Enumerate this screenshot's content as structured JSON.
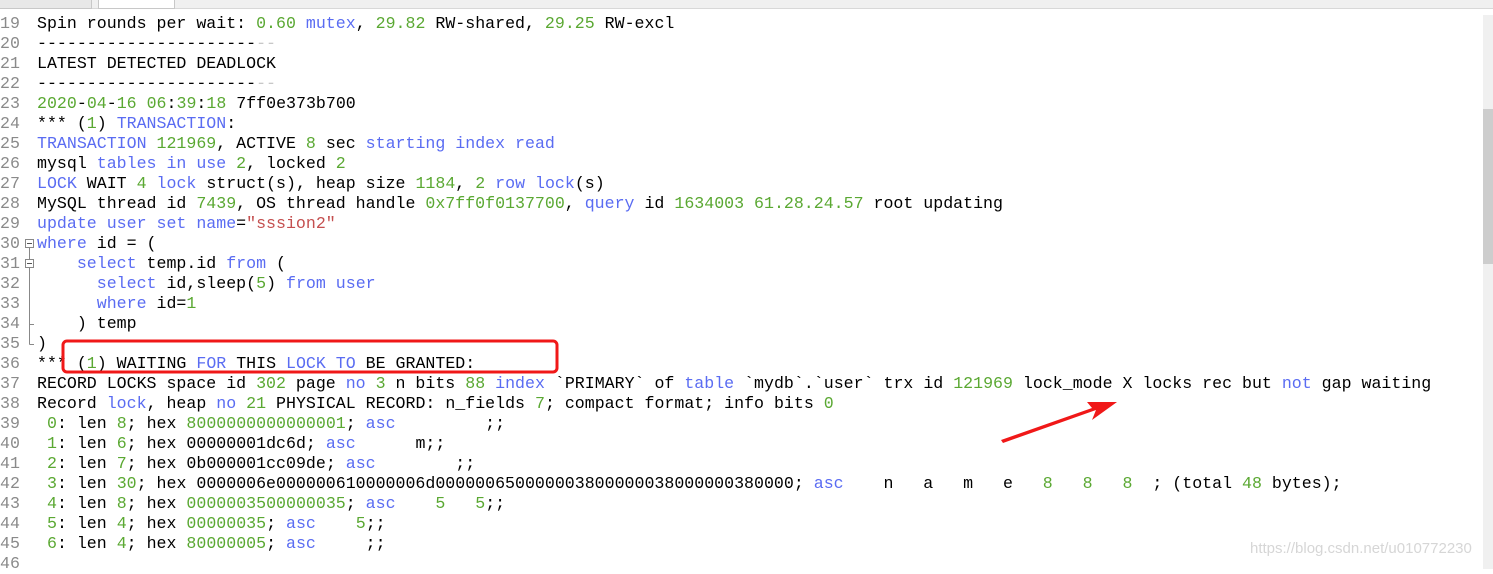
{
  "colors": {
    "keyword": "#5a6cf2",
    "number": "#5aa832",
    "string": "#c44f4f",
    "faded": "#c8c8c8",
    "annotation": "#f01818"
  },
  "lines": [
    {
      "n": "19",
      "t": [
        [
          "Spin rounds per wait: ",
          ""
        ],
        [
          "0.60",
          "n"
        ],
        [
          " ",
          ""
        ],
        [
          "mutex",
          "k"
        ],
        [
          ", ",
          ""
        ],
        [
          "29.82",
          "n"
        ],
        [
          " RW-shared, ",
          ""
        ],
        [
          "29.25",
          "n"
        ],
        [
          " RW-excl",
          ""
        ]
      ]
    },
    {
      "n": "20",
      "t": [
        [
          "----------------------",
          ""
        ],
        [
          "--",
          "d"
        ]
      ]
    },
    {
      "n": "21",
      "t": [
        [
          "LATEST DETECTED DEADLOCK",
          ""
        ]
      ]
    },
    {
      "n": "22",
      "t": [
        [
          "----------------------",
          ""
        ],
        [
          "--",
          "d"
        ]
      ]
    },
    {
      "n": "23",
      "t": [
        [
          "2020",
          "n"
        ],
        [
          "-",
          ""
        ],
        [
          "04",
          "n"
        ],
        [
          "-",
          ""
        ],
        [
          "16",
          "n"
        ],
        [
          " ",
          ""
        ],
        [
          "06",
          "n"
        ],
        [
          ":",
          ""
        ],
        [
          "39",
          "n"
        ],
        [
          ":",
          ""
        ],
        [
          "18",
          "n"
        ],
        [
          " 7ff0e373b700",
          ""
        ]
      ]
    },
    {
      "n": "24",
      "t": [
        [
          "*** (",
          ""
        ],
        [
          "1",
          "n"
        ],
        [
          ") ",
          ""
        ],
        [
          "TRANSACTION",
          "k"
        ],
        [
          ":",
          ""
        ]
      ]
    },
    {
      "n": "25",
      "t": [
        [
          "TRANSACTION",
          "k"
        ],
        [
          " ",
          ""
        ],
        [
          "121969",
          "n"
        ],
        [
          ", ACTIVE ",
          ""
        ],
        [
          "8",
          "n"
        ],
        [
          " sec ",
          ""
        ],
        [
          "starting index read",
          "k"
        ]
      ]
    },
    {
      "n": "26",
      "t": [
        [
          "mysql ",
          ""
        ],
        [
          "tables in use",
          "k"
        ],
        [
          " ",
          ""
        ],
        [
          "2",
          "n"
        ],
        [
          ", locked ",
          ""
        ],
        [
          "2",
          "n"
        ]
      ]
    },
    {
      "n": "27",
      "t": [
        [
          "LOCK",
          "k"
        ],
        [
          " WAIT ",
          ""
        ],
        [
          "4",
          "n"
        ],
        [
          " ",
          ""
        ],
        [
          "lock",
          "k"
        ],
        [
          " struct(s), heap size ",
          ""
        ],
        [
          "1184",
          "n"
        ],
        [
          ", ",
          ""
        ],
        [
          "2",
          "n"
        ],
        [
          " ",
          ""
        ],
        [
          "row lock",
          "k"
        ],
        [
          "(s)",
          ""
        ]
      ]
    },
    {
      "n": "28",
      "t": [
        [
          "MySQL thread id ",
          ""
        ],
        [
          "7439",
          "n"
        ],
        [
          ", OS thread handle ",
          ""
        ],
        [
          "0x7ff0f0137700",
          "n"
        ],
        [
          ", ",
          ""
        ],
        [
          "query",
          "k"
        ],
        [
          " id ",
          ""
        ],
        [
          "1634003 61.28.24.57",
          "n"
        ],
        [
          " root updating",
          ""
        ]
      ]
    },
    {
      "n": "29",
      "t": [
        [
          "update user set name",
          "k"
        ],
        [
          "=",
          ""
        ],
        [
          "\"sssion2\"",
          "s"
        ]
      ]
    },
    {
      "n": "30",
      "fold": "open",
      "t": [
        [
          "where",
          "k"
        ],
        [
          " id = (",
          ""
        ]
      ]
    },
    {
      "n": "31",
      "fold": "open2",
      "t": [
        [
          "    ",
          ""
        ],
        [
          "select",
          "k"
        ],
        [
          " temp.id ",
          ""
        ],
        [
          "from",
          "k"
        ],
        [
          " (",
          ""
        ]
      ]
    },
    {
      "n": "32",
      "fold": "bar2",
      "t": [
        [
          "      ",
          ""
        ],
        [
          "select",
          "k"
        ],
        [
          " id,sleep(",
          ""
        ],
        [
          "5",
          "n"
        ],
        [
          ") ",
          ""
        ],
        [
          "from user",
          "k"
        ]
      ]
    },
    {
      "n": "33",
      "fold": "bar2",
      "t": [
        [
          "      ",
          ""
        ],
        [
          "where",
          "k"
        ],
        [
          " id=",
          ""
        ],
        [
          "1",
          "n"
        ]
      ]
    },
    {
      "n": "34",
      "fold": "end2",
      "t": [
        [
          "    ) temp",
          ""
        ]
      ]
    },
    {
      "n": "35",
      "fold": "end",
      "t": [
        [
          ")",
          ""
        ]
      ]
    },
    {
      "n": "36",
      "t": [
        [
          "*** (",
          ""
        ],
        [
          "1",
          "n"
        ],
        [
          ") WAITING ",
          ""
        ],
        [
          "FOR",
          "k"
        ],
        [
          " THIS ",
          ""
        ],
        [
          "LOCK TO",
          "k"
        ],
        [
          " BE GRANTED:",
          ""
        ]
      ]
    },
    {
      "n": "37",
      "t": [
        [
          "RECORD LOCKS space id ",
          ""
        ],
        [
          "302",
          "n"
        ],
        [
          " page ",
          ""
        ],
        [
          "no",
          "k"
        ],
        [
          " ",
          ""
        ],
        [
          "3",
          "n"
        ],
        [
          " n bits ",
          ""
        ],
        [
          "88",
          "n"
        ],
        [
          " ",
          ""
        ],
        [
          "index",
          "k"
        ],
        [
          " `PRIMARY` of ",
          ""
        ],
        [
          "table",
          "k"
        ],
        [
          " `mydb`.`user` trx id ",
          ""
        ],
        [
          "121969",
          "n"
        ],
        [
          " lock_mode X locks rec but ",
          ""
        ],
        [
          "not",
          "k"
        ],
        [
          " gap waiting",
          ""
        ]
      ]
    },
    {
      "n": "38",
      "t": [
        [
          "Record ",
          ""
        ],
        [
          "lock",
          "k"
        ],
        [
          ", heap ",
          ""
        ],
        [
          "no",
          "k"
        ],
        [
          " ",
          ""
        ],
        [
          "21",
          "n"
        ],
        [
          " PHYSICAL RECORD: n_fields ",
          ""
        ],
        [
          "7",
          "n"
        ],
        [
          "; compact format; info bits ",
          ""
        ],
        [
          "0",
          "n"
        ]
      ]
    },
    {
      "n": "39",
      "t": [
        [
          " ",
          ""
        ],
        [
          "0",
          "n"
        ],
        [
          ": len ",
          ""
        ],
        [
          "8",
          "n"
        ],
        [
          "; hex ",
          ""
        ],
        [
          "8000000000000001",
          "n"
        ],
        [
          "; ",
          ""
        ],
        [
          "asc",
          "k"
        ],
        [
          "         ;;",
          ""
        ]
      ]
    },
    {
      "n": "40",
      "t": [
        [
          " ",
          ""
        ],
        [
          "1",
          "n"
        ],
        [
          ": len ",
          ""
        ],
        [
          "6",
          "n"
        ],
        [
          "; hex 00000001dc6d; ",
          ""
        ],
        [
          "asc",
          "k"
        ],
        [
          "      m;;",
          ""
        ]
      ]
    },
    {
      "n": "41",
      "t": [
        [
          " ",
          ""
        ],
        [
          "2",
          "n"
        ],
        [
          ": len ",
          ""
        ],
        [
          "7",
          "n"
        ],
        [
          "; hex 0b000001cc09de; ",
          ""
        ],
        [
          "asc",
          "k"
        ],
        [
          "        ;;",
          ""
        ]
      ]
    },
    {
      "n": "42",
      "t": [
        [
          " ",
          ""
        ],
        [
          "3",
          "n"
        ],
        [
          ": len ",
          ""
        ],
        [
          "30",
          "n"
        ],
        [
          "; hex 0000006e000000610000006d000000650000003800000038000000380000; ",
          ""
        ],
        [
          "asc",
          "k"
        ],
        [
          "    n   a   m   e   ",
          ""
        ],
        [
          "8",
          "n"
        ],
        [
          "   ",
          ""
        ],
        [
          "8",
          "n"
        ],
        [
          "   ",
          ""
        ],
        [
          "8",
          "n"
        ],
        [
          "  ; (total ",
          ""
        ],
        [
          "48",
          "n"
        ],
        [
          " bytes);",
          ""
        ]
      ]
    },
    {
      "n": "43",
      "t": [
        [
          " ",
          ""
        ],
        [
          "4",
          "n"
        ],
        [
          ": len ",
          ""
        ],
        [
          "8",
          "n"
        ],
        [
          "; hex ",
          ""
        ],
        [
          "0000003500000035",
          "n"
        ],
        [
          "; ",
          ""
        ],
        [
          "asc",
          "k"
        ],
        [
          "    ",
          ""
        ],
        [
          "5",
          "n"
        ],
        [
          "   ",
          ""
        ],
        [
          "5",
          "n"
        ],
        [
          ";;",
          ""
        ]
      ]
    },
    {
      "n": "44",
      "t": [
        [
          " ",
          ""
        ],
        [
          "5",
          "n"
        ],
        [
          ": len ",
          ""
        ],
        [
          "4",
          "n"
        ],
        [
          "; hex ",
          ""
        ],
        [
          "00000035",
          "n"
        ],
        [
          "; ",
          ""
        ],
        [
          "asc",
          "k"
        ],
        [
          "    ",
          ""
        ],
        [
          "5",
          "n"
        ],
        [
          ";;",
          ""
        ]
      ]
    },
    {
      "n": "45",
      "t": [
        [
          " ",
          ""
        ],
        [
          "6",
          "n"
        ],
        [
          ": len ",
          ""
        ],
        [
          "4",
          "n"
        ],
        [
          "; hex ",
          ""
        ],
        [
          "80000005",
          "n"
        ],
        [
          "; ",
          ""
        ],
        [
          "asc",
          "k"
        ],
        [
          "     ;;",
          ""
        ]
      ]
    },
    {
      "n": "46",
      "t": []
    }
  ],
  "watermark": "https://blog.csdn.net/u010772230"
}
